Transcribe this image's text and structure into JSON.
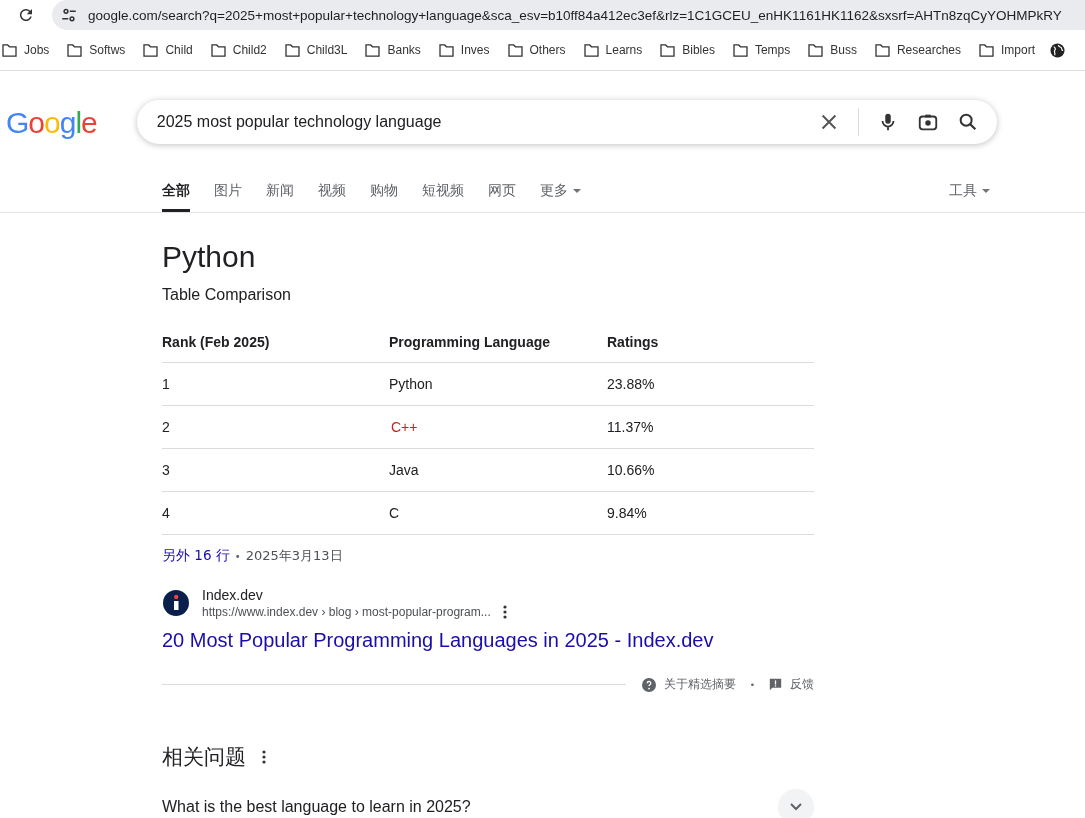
{
  "browser": {
    "url": "google.com/search?q=2025+most+popular+technology+language&sca_esv=b10ff84a412ec3ef&rlz=1C1GCEU_enHK1161HK1162&sxsrf=AHTn8zqCyYOHMPkRY",
    "bookmarks": [
      {
        "label": "Jobs"
      },
      {
        "label": "Softws"
      },
      {
        "label": "Child"
      },
      {
        "label": "Child2"
      },
      {
        "label": "Child3L"
      },
      {
        "label": "Banks"
      },
      {
        "label": "Inves"
      },
      {
        "label": "Others"
      },
      {
        "label": "Learns"
      },
      {
        "label": "Bibles"
      },
      {
        "label": "Temps"
      },
      {
        "label": "Buss"
      },
      {
        "label": "Researches"
      },
      {
        "label": "Import"
      }
    ]
  },
  "logo": "Google",
  "search": {
    "value": "2025 most popular technology language"
  },
  "tabs": [
    {
      "label": "全部",
      "selected": true,
      "dropdown": false
    },
    {
      "label": "图片",
      "selected": false,
      "dropdown": false
    },
    {
      "label": "新闻",
      "selected": false,
      "dropdown": false
    },
    {
      "label": "视频",
      "selected": false,
      "dropdown": false
    },
    {
      "label": "购物",
      "selected": false,
      "dropdown": false
    },
    {
      "label": "短视频",
      "selected": false,
      "dropdown": false
    },
    {
      "label": "网页",
      "selected": false,
      "dropdown": false
    },
    {
      "label": "更多",
      "selected": false,
      "dropdown": true
    }
  ],
  "tools": "工具",
  "snippet": {
    "title": "Python",
    "subtitle": "Table Comparison",
    "table": {
      "columns": [
        "Rank (Feb 2025)",
        "Programming Language",
        "Ratings"
      ],
      "rows": [
        {
          "rank": "1",
          "language": "Python",
          "linked": false,
          "rating": "23.88%"
        },
        {
          "rank": "2",
          "language": "C++",
          "linked": true,
          "rating": "11.37%"
        },
        {
          "rank": "3",
          "language": "Java",
          "linked": false,
          "rating": "10.66%"
        },
        {
          "rank": "4",
          "language": "C",
          "linked": false,
          "rating": "9.84%"
        }
      ]
    },
    "more_rows": "另外 16 行",
    "separator": "•",
    "date": "2025年3月13日",
    "source": {
      "site": "Index.dev",
      "url": "https://www.index.dev › blog › most-popular-program...",
      "title": "20 Most Popular Programming Languages in 2025 - Index.dev"
    },
    "about": "关于精选摘要",
    "footer_separator": "•",
    "feedback": "反馈"
  },
  "related": {
    "title": "相关问题",
    "questions": [
      {
        "text": "What is the best language to learn in 2025?",
        "expanded": false
      }
    ]
  }
}
